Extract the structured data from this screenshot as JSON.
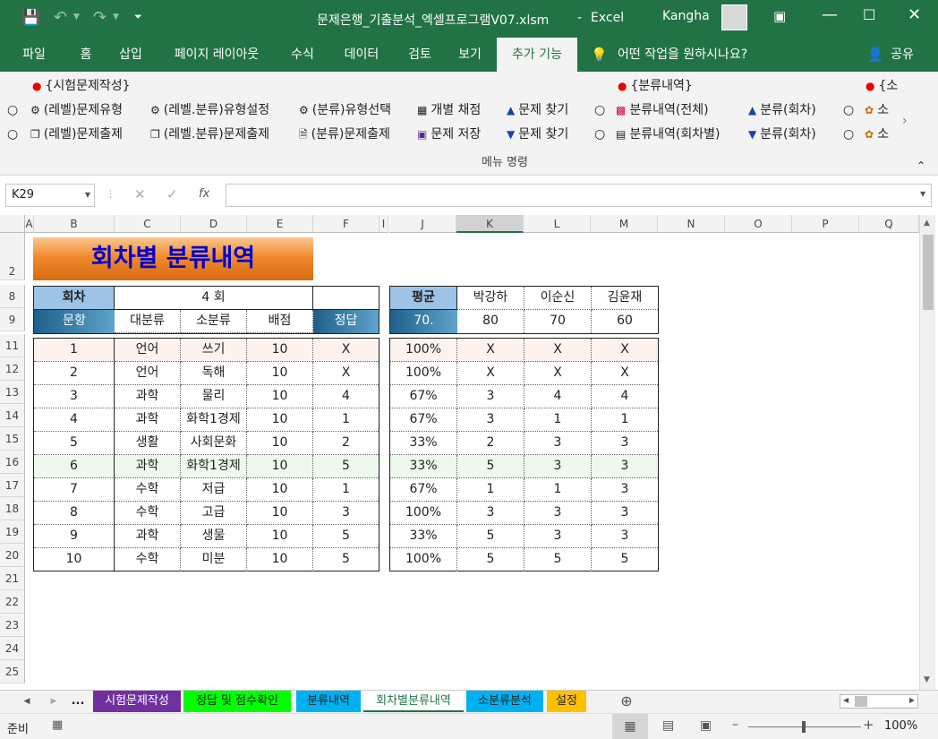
{
  "title_bar": {
    "document": "문제은행_기출분석_엑셀프로그램V07.xlsm",
    "separator": "-",
    "app": "Excel",
    "user": "Kangha"
  },
  "tabs": [
    "파일",
    "홈",
    "삽입",
    "페이지 레이아웃",
    "수식",
    "데이터",
    "검토",
    "보기",
    "추가 기능"
  ],
  "tell_me": "어떤 작업을 원하시나요?",
  "share": "공유",
  "ribbon": {
    "group_labels": [
      "{시험문제작성}",
      "{분류내역}",
      "{소"
    ],
    "row1": [
      "(레벨)문제유형",
      "(레벨.분류)유형설정",
      "(분류)유형선택",
      "개별 채점",
      "문제 찾기",
      "분류내역(전체)",
      "분류(회차)",
      "소"
    ],
    "row2": [
      "(레벨)문제출제",
      "(레벨.분류)문제출제",
      "(분류)문제출제",
      "문제 저장",
      "문제 찾기",
      "분류내역(회차별)",
      "분류(회차)",
      "소"
    ],
    "footer": "메뉴 명령"
  },
  "formula_bar": {
    "name_box": "K29",
    "fx": "fx",
    "value": ""
  },
  "columns": [
    "A",
    "B",
    "C",
    "D",
    "E",
    "F",
    "I",
    "J",
    "K",
    "L",
    "M",
    "N",
    "O",
    "P",
    "Q"
  ],
  "rows": [
    "2",
    "8",
    "9",
    "11",
    "12",
    "13",
    "14",
    "15",
    "16",
    "17",
    "18",
    "19",
    "20",
    "21",
    "22",
    "23",
    "24",
    "25"
  ],
  "sheet": {
    "banner": "회차별 분류내역",
    "round_label": "회차",
    "round_value": "4 회",
    "headers": [
      "문항",
      "대분류",
      "소분류",
      "배점",
      "정답"
    ],
    "score_header": "평균",
    "students": [
      "박강하",
      "이순신",
      "김윤재"
    ],
    "avg_value": "70.",
    "student_scores": [
      "80",
      "70",
      "60"
    ],
    "items": [
      {
        "no": "1",
        "major": "언어",
        "minor": "쓰기",
        "points": "10",
        "answer": "X",
        "avg": "100%",
        "s": [
          "X",
          "X",
          "X"
        ]
      },
      {
        "no": "2",
        "major": "언어",
        "minor": "독해",
        "points": "10",
        "answer": "X",
        "avg": "100%",
        "s": [
          "X",
          "X",
          "X"
        ]
      },
      {
        "no": "3",
        "major": "과학",
        "minor": "물리",
        "points": "10",
        "answer": "4",
        "avg": "67%",
        "s": [
          "3",
          "4",
          "4"
        ]
      },
      {
        "no": "4",
        "major": "과학",
        "minor": "화학1경제",
        "points": "10",
        "answer": "1",
        "avg": "67%",
        "s": [
          "3",
          "1",
          "1"
        ]
      },
      {
        "no": "5",
        "major": "생활",
        "minor": "사회문화",
        "points": "10",
        "answer": "2",
        "avg": "33%",
        "s": [
          "2",
          "3",
          "3"
        ]
      },
      {
        "no": "6",
        "major": "과학",
        "minor": "화학1경제",
        "points": "10",
        "answer": "5",
        "avg": "33%",
        "s": [
          "5",
          "3",
          "3"
        ]
      },
      {
        "no": "7",
        "major": "수학",
        "minor": "저급",
        "points": "10",
        "answer": "1",
        "avg": "67%",
        "s": [
          "1",
          "1",
          "3"
        ]
      },
      {
        "no": "8",
        "major": "수학",
        "minor": "고급",
        "points": "10",
        "answer": "3",
        "avg": "100%",
        "s": [
          "3",
          "3",
          "3"
        ]
      },
      {
        "no": "9",
        "major": "과학",
        "minor": "생물",
        "points": "10",
        "answer": "5",
        "avg": "33%",
        "s": [
          "5",
          "3",
          "3"
        ]
      },
      {
        "no": "10",
        "major": "수학",
        "minor": "미분",
        "points": "10",
        "answer": "5",
        "avg": "100%",
        "s": [
          "5",
          "5",
          "5"
        ]
      }
    ]
  },
  "sheet_tabs": [
    {
      "label": "시험문제작성",
      "color": "#7030a0",
      "text": "#ffffff"
    },
    {
      "label": "정답 및 점수확인",
      "color": "#00ff00",
      "text": "#222222"
    },
    {
      "label": "분류내역",
      "color": "#00b0f0",
      "text": "#222222"
    },
    {
      "label": "회차별분류내역",
      "color": "#f3f3f3",
      "text": "#222222",
      "active": true
    },
    {
      "label": "소분류분석",
      "color": "#00b0f0",
      "text": "#222222"
    },
    {
      "label": "설정",
      "color": "#ffc000",
      "text": "#222222"
    }
  ],
  "sheet_nav_more": "...",
  "status": {
    "ready": "준비",
    "zoom": "100%"
  },
  "colors": {
    "excel_green": "#217346",
    "banner_orange": "#f28a30",
    "banner_text": "#0000cc",
    "header_blue": "#9dc3e6",
    "header_dark": "#1f5f8b"
  }
}
